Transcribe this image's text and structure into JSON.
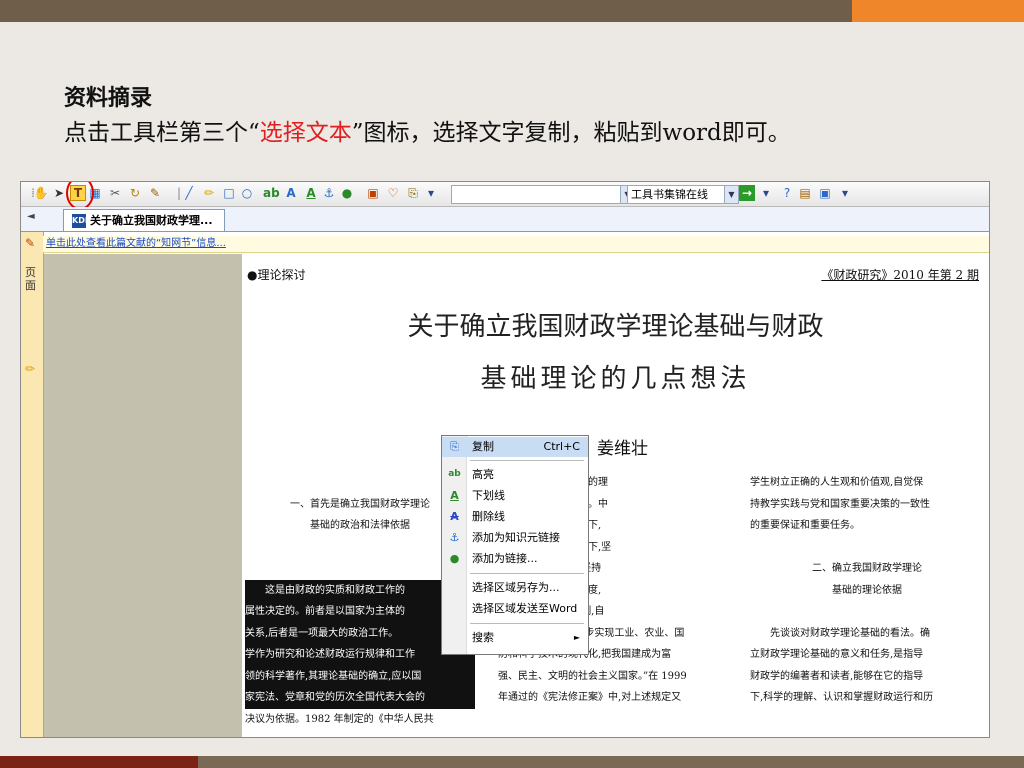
{
  "slide": {
    "title": "资料摘录",
    "instruction_pre": "点击工具栏第三个“",
    "instruction_highlight": "选择文本",
    "instruction_post": "”图标，选择文字复制，粘贴到word即可。",
    "highlight_color": "#e02020"
  },
  "app": {
    "toolbar": {
      "combo_left_value": "",
      "combo_right_value": "工具书集锦在线"
    },
    "tab": {
      "label": "关于确立我国财政学理...",
      "icon_text": "KDH"
    },
    "side_label": "页面",
    "info_link": "单击此处查看此篇文献的“知网节”信息..."
  },
  "document": {
    "section_label": "●理论探讨",
    "journal": "《财政研究》2010 年第 2 期",
    "title_line1": "关于确立我国财政学理论基础与财政",
    "title_line2": "基础理论的几点想法",
    "author": "姜维壮",
    "col1": {
      "head1": "一、首先是确立我国财政学理论",
      "head2": "基础的政治和法律依据",
      "lines": [
        "这是由财政的实质和财政工作的",
        "属性决定的。前者是以国家为主体的",
        "关系,后者是一项最大的政治工作。",
        "学作为研究和论述财政运行规律和工作",
        "领的科学著作,其理论基础的确立,应以国",
        "家宪法、党章和党的历次全国代表大会的",
        "决议为依据。1982 年制定的《中华人民共"
      ]
    },
    "col2": {
      "lines": [
        "中国特色的社会主义的理",
        "社会主义现代化建设。中",
        "线在中国共产党领导下,",
        "义、毛泽东思想指引下,坚",
        "坚持社会主义道路,坚持",
        "善社会主义的各项制度,",
        "主,健全社会主义法制,自",
        "力更生,艰苦奋斗,逐步实现工业、农业、国",
        "防和科学技术的现代化,把我国建成为富",
        "强、民主、文明的社会主义国家。”在 1999",
        "年通过的《宪法修正案》中,对上述规定又"
      ]
    },
    "col3": {
      "lines": [
        "学生树立正确的人生观和价值观,自觉保",
        "持教学实践与党和国家重要决策的一致性",
        "的重要保证和重要任务。"
      ],
      "head1": "二、确立我国财政学理论",
      "head2": "基础的理论依据",
      "lines2": [
        "先谈谈对财政学理论基础的看法。确",
        "立财政学理论基础的意义和任务,是指导",
        "财政学的编著者和读者,能够在它的指导",
        "下,科学的理解、认识和掌握财政运行和历"
      ]
    }
  },
  "context_menu": {
    "items": [
      {
        "label": "复制",
        "shortcut": "Ctrl+C",
        "icon": "copy-icon"
      },
      {
        "label": "高亮",
        "icon": "highlight-icon"
      },
      {
        "label": "下划线",
        "icon": "underline-icon"
      },
      {
        "label": "删除线",
        "icon": "strikethrough-icon"
      },
      {
        "label": "添加为知识元链接",
        "icon": "anchor-icon"
      },
      {
        "label": "添加为链接...",
        "icon": "link-icon"
      },
      {
        "label": "选择区域另存为..."
      },
      {
        "label": "选择区域发送至Word"
      },
      {
        "label": "搜索",
        "submenu_arrow": "►"
      }
    ]
  }
}
